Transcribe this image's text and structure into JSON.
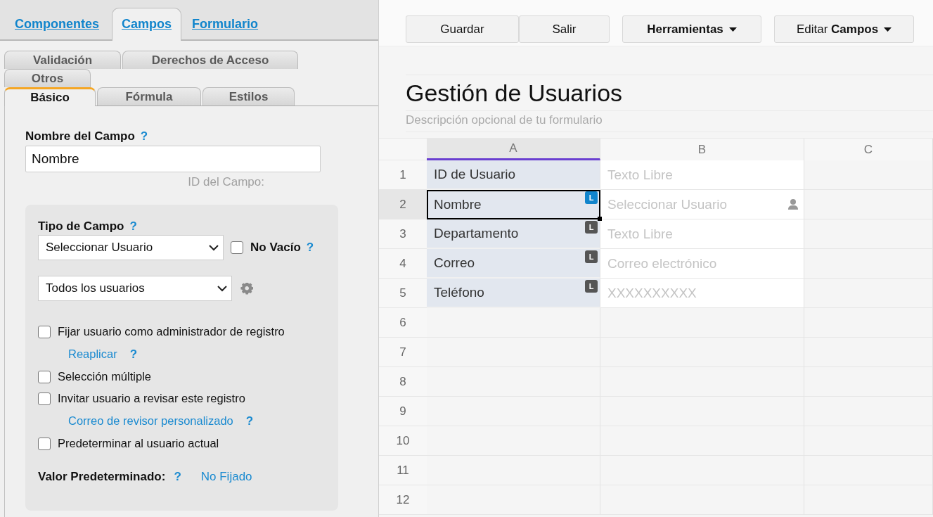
{
  "top_tabs": [
    {
      "label": "Componentes",
      "selected": false
    },
    {
      "label": "Campos",
      "selected": true
    },
    {
      "label": "Formulario",
      "selected": false
    }
  ],
  "sub_tab_rows": [
    [
      {
        "label": "Validación",
        "selected": false
      },
      {
        "label": "Derechos de Acceso",
        "selected": false
      }
    ],
    [
      {
        "label": "Otros",
        "selected": false
      }
    ],
    [
      {
        "label": "Básico",
        "selected": true
      },
      {
        "label": "Fórmula",
        "selected": false
      },
      {
        "label": "Estilos",
        "selected": false
      }
    ]
  ],
  "field_name": {
    "label": "Nombre del Campo",
    "help": "?",
    "value": "Nombre",
    "id_label": "ID del Campo:"
  },
  "field_type": {
    "label": "Tipo de Campo",
    "help": "?",
    "select": "Seleccionar Usuario",
    "required": {
      "label": "No Vacío",
      "checked": false,
      "help": "?"
    },
    "user_scope": "Todos los usuarios"
  },
  "options": [
    {
      "kind": "checkbox",
      "label": "Fijar usuario como administrador de registro",
      "checked": false
    },
    {
      "kind": "link",
      "label": "Reaplicar",
      "help": "?"
    },
    {
      "kind": "checkbox",
      "label": "Selección múltiple",
      "checked": false
    },
    {
      "kind": "checkbox",
      "label": "Invitar usuario a revisar este registro",
      "checked": false
    },
    {
      "kind": "link",
      "label": "Correo de revisor personalizado",
      "help": "?"
    },
    {
      "kind": "checkbox",
      "label": "Predeterminar al usuario actual",
      "checked": false
    }
  ],
  "default_value": {
    "label": "Valor Predeterminado:",
    "help": "?",
    "value": "No Fijado"
  },
  "toolbar": [
    {
      "label": "Guardar",
      "kind": "plain",
      "bold": false
    },
    {
      "label": "Salir",
      "kind": "plain",
      "bold": false
    },
    {
      "label": "Herramientas",
      "kind": "menu",
      "bold": true
    },
    {
      "label": "Editar **Campos**",
      "kind": "menu",
      "bold": false
    }
  ],
  "form": {
    "title": "Gestión de Usuarios",
    "description": "Descripción opcional de tu formulario"
  },
  "grid": {
    "columns": [
      {
        "label": "A",
        "selected": true
      },
      {
        "label": "B",
        "selected": false
      },
      {
        "label": "C",
        "selected": false
      }
    ],
    "rows": [
      {
        "number": "1",
        "selected": false,
        "label": "ID de Usuario",
        "value": "Texto Libre",
        "user_icon": false
      },
      {
        "number": "2",
        "selected": true,
        "label": "Nombre",
        "badge": "L",
        "value": "Seleccionar Usuario",
        "user_icon": true
      },
      {
        "number": "3",
        "selected": false,
        "label": "Departamento",
        "badge": "L",
        "value": "Texto Libre",
        "user_icon": false
      },
      {
        "number": "4",
        "selected": false,
        "label": "Correo",
        "badge": "L",
        "value": "Correo electrónico",
        "user_icon": false
      },
      {
        "number": "5",
        "selected": false,
        "label": "Teléfono",
        "badge": "L",
        "value": "XXXXXXXXXX",
        "user_icon": false
      },
      {
        "number": "6",
        "selected": false
      },
      {
        "number": "7",
        "selected": false
      },
      {
        "number": "8",
        "selected": false
      },
      {
        "number": "9",
        "selected": false
      },
      {
        "number": "10",
        "selected": false
      },
      {
        "number": "11",
        "selected": false
      },
      {
        "number": "12",
        "selected": false
      }
    ]
  }
}
